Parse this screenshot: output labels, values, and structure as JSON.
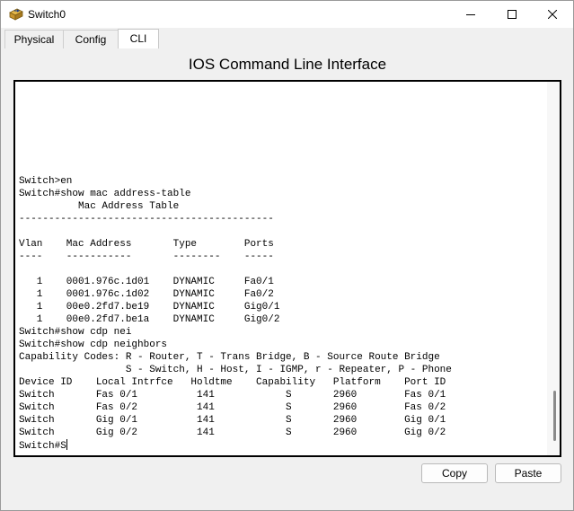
{
  "window": {
    "title": "Switch0",
    "minimize_icon": "minimize-icon",
    "maximize_icon": "maximize-icon",
    "close_icon": "close-icon",
    "app_icon": "switch-app-icon"
  },
  "tabs": [
    {
      "label": "Physical"
    },
    {
      "label": "Config"
    },
    {
      "label": "CLI",
      "active": true
    }
  ],
  "cli": {
    "title": "IOS Command Line Interface",
    "lines": [
      "Switch>en",
      "Switch#show mac address-table",
      "          Mac Address Table",
      "-------------------------------------------",
      "",
      "Vlan    Mac Address       Type        Ports",
      "----    -----------       --------    -----",
      "",
      "   1    0001.976c.1d01    DYNAMIC     Fa0/1",
      "   1    0001.976c.1d02    DYNAMIC     Fa0/2",
      "   1    00e0.2fd7.be19    DYNAMIC     Gig0/1",
      "   1    00e0.2fd7.be1a    DYNAMIC     Gig0/2",
      "Switch#show cdp nei",
      "Switch#show cdp neighbors",
      "Capability Codes: R - Router, T - Trans Bridge, B - Source Route Bridge",
      "                  S - Switch, H - Host, I - IGMP, r - Repeater, P - Phone",
      "Device ID    Local Intrfce   Holdtme    Capability   Platform    Port ID",
      "Switch       Fas 0/1          141            S       2960        Fas 0/1",
      "Switch       Fas 0/2          141            S       2960        Fas 0/2",
      "Switch       Gig 0/1          141            S       2960        Gig 0/1",
      "Switch       Gig 0/2          141            S       2960        Gig 0/2"
    ],
    "prompt": "Switch#S"
  },
  "buttons": {
    "copy": "Copy",
    "paste": "Paste"
  }
}
